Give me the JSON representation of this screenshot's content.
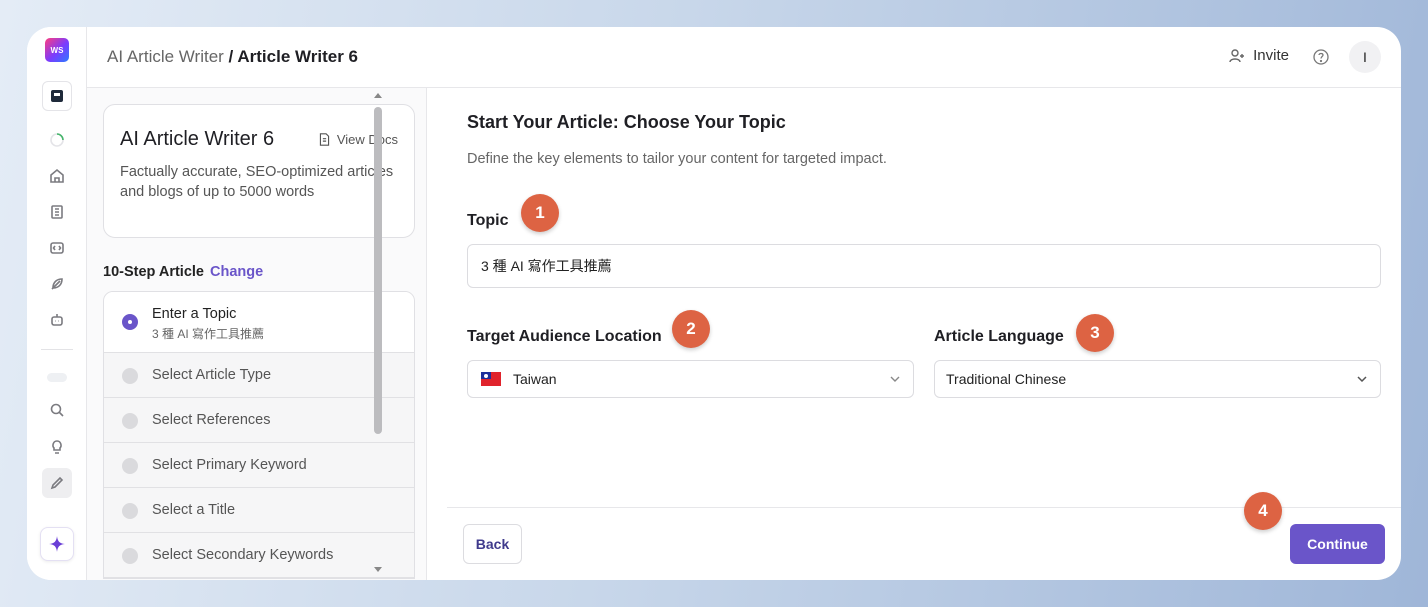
{
  "header": {
    "breadcrumb_parent": "AI Article Writer",
    "breadcrumb_sep": " / ",
    "breadcrumb_current": "Article Writer 6",
    "invite_label": "Invite",
    "avatar_initial": "I"
  },
  "rail": {
    "logo_text": "WS",
    "icons": [
      "app-icon",
      "loading-icon",
      "home-icon",
      "notebook-icon",
      "code-icon",
      "feather-icon",
      "bot-icon",
      "search-icon",
      "lightbulb-icon",
      "pencil-icon",
      "sparkle-icon"
    ]
  },
  "sidebar": {
    "card_title": "AI Article Writer 6",
    "docs_label": "View Docs",
    "card_desc": "Factually accurate, SEO-optimized articles and blogs of up to 5000 words",
    "steps_title": "10-Step Article",
    "change_label": "Change",
    "steps": [
      {
        "label": "Enter a Topic",
        "sub": "3 種 AI 寫作工具推薦"
      },
      {
        "label": "Select Article Type"
      },
      {
        "label": "Select References"
      },
      {
        "label": "Select Primary Keyword"
      },
      {
        "label": "Select a Title"
      },
      {
        "label": "Select Secondary Keywords"
      }
    ]
  },
  "main": {
    "title": "Start Your Article: Choose Your Topic",
    "subtitle": "Define the key elements to tailor your content for targeted impact.",
    "topic_label": "Topic",
    "topic_value": "3 種 AI 寫作工具推薦",
    "location_label": "Target Audience Location",
    "location_value": "Taiwan",
    "language_label": "Article Language",
    "language_value": "Traditional Chinese",
    "badges": [
      "1",
      "2",
      "3",
      "4"
    ],
    "back_label": "Back",
    "continue_label": "Continue"
  },
  "colors": {
    "accent": "#6a55c9",
    "badge": "#dd6343"
  }
}
